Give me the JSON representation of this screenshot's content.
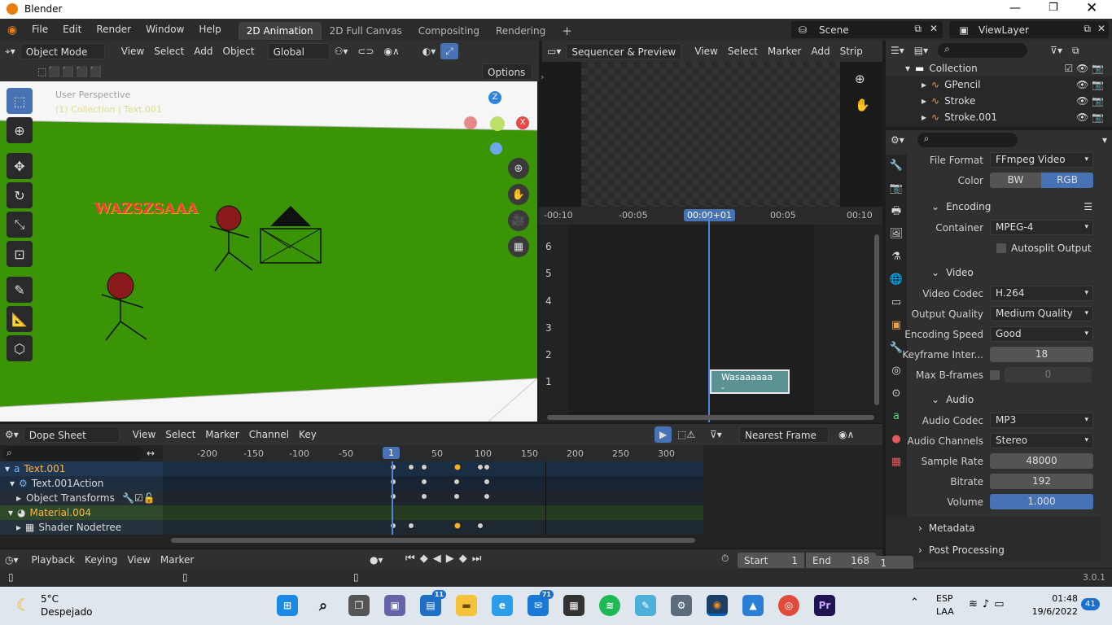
{
  "window": {
    "title": "Blender"
  },
  "menu": [
    "File",
    "Edit",
    "Render",
    "Window",
    "Help"
  ],
  "workspaces": [
    {
      "label": "2D Animation",
      "active": true
    },
    {
      "label": "2D Full Canvas"
    },
    {
      "label": "Compositing"
    },
    {
      "label": "Rendering"
    },
    {
      "label": "+"
    }
  ],
  "scene": {
    "name": "Scene",
    "view_layer": "ViewLayer"
  },
  "viewport": {
    "mode": "Object Mode",
    "menus": [
      "View",
      "Select",
      "Add",
      "Object"
    ],
    "orientation": "Global",
    "options": "Options",
    "overlay_title": "User Perspective",
    "overlay_sub": "(1) Collection | Text.001",
    "text_object": "WAZSZSAAA",
    "gizmo": {
      "z": "Z",
      "x": "X"
    }
  },
  "sequencer": {
    "mode": "Sequencer & Preview",
    "menus": [
      "View",
      "Select",
      "Marker",
      "Add",
      "Strip"
    ],
    "ticks": [
      "-00:10",
      "-00:05",
      "00:00+01",
      "00:05",
      "00:10"
    ],
    "channels": [
      "6",
      "5",
      "4",
      "3",
      "2",
      "1"
    ],
    "strip": "Wasaaaaaa -"
  },
  "outliner": {
    "items": [
      {
        "label": "Collection"
      },
      {
        "label": "GPencil"
      },
      {
        "label": "Stroke"
      },
      {
        "label": "Stroke.001"
      }
    ]
  },
  "properties": {
    "file_format_label": "File Format",
    "file_format": "FFmpeg Video",
    "color_label": "Color",
    "color_bw": "BW",
    "color_rgb": "RGB",
    "encoding": "Encoding",
    "container_label": "Container",
    "container": "MPEG-4",
    "autosplit": "Autosplit Output",
    "video": "Video",
    "codec_label": "Video Codec",
    "codec": "H.264",
    "quality_label": "Output Quality",
    "quality": "Medium Quality",
    "speed_label": "Encoding Speed",
    "speed": "Good",
    "keyint_label": "Keyframe Inter...",
    "keyint": "18",
    "bframes_label": "Max B-frames",
    "bframes": "0",
    "audio": "Audio",
    "acodec_label": "Audio Codec",
    "acodec": "MP3",
    "channels_label": "Audio Channels",
    "channels": "Stereo",
    "rate_label": "Sample Rate",
    "rate": "48000",
    "bitrate_label": "Bitrate",
    "bitrate": "192",
    "volume_label": "Volume",
    "volume": "1.000",
    "metadata": "Metadata",
    "post": "Post Processing"
  },
  "dopesheet": {
    "mode": "Dope Sheet",
    "menus": [
      "View",
      "Select",
      "Marker",
      "Channel",
      "Key"
    ],
    "snap": "Nearest Frame",
    "ticks": [
      "-200",
      "-150",
      "-100",
      "-50",
      "1",
      "50",
      "100",
      "150",
      "200",
      "250",
      "300"
    ],
    "channels": [
      "Text.001",
      "Text.001Action",
      "Object Transforms",
      "Material.004",
      "Shader Nodetree"
    ]
  },
  "timeline": {
    "menus": [
      "Playback",
      "Keying",
      "View",
      "Marker"
    ],
    "current": "1",
    "start_label": "Start",
    "start": "1",
    "end_label": "End",
    "end": "168"
  },
  "status": {
    "version": "3.0.1"
  },
  "taskbar": {
    "temp": "5°C",
    "weather": "Despejado",
    "lang": "ESP",
    "lang2": "LAA",
    "time": "01:48",
    "date": "19/6/2022",
    "notif": "41",
    "badge_mail": "71",
    "badge_teams": "11"
  }
}
